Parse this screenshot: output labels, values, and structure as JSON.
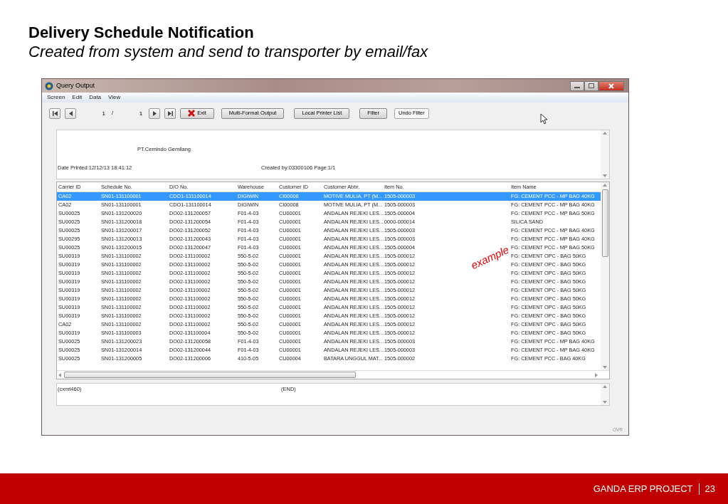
{
  "slide": {
    "title": "Delivery Schedule Notification",
    "subtitle": "Created from system and send to transporter by email/fax",
    "annotation": "example",
    "footer": {
      "project": "GANDA ERP PROJECT",
      "page": "23"
    }
  },
  "window": {
    "title": "Query Output",
    "menu": [
      "Screen",
      "Edit",
      "Data",
      "View"
    ],
    "toolbar": [
      {
        "kind": "first"
      },
      {
        "kind": "prev"
      },
      {
        "kind": "field",
        "value": "1"
      },
      {
        "kind": "text",
        "label": "/"
      },
      {
        "kind": "field",
        "value": "1"
      },
      {
        "kind": "next"
      },
      {
        "kind": "last"
      },
      {
        "kind": "exit",
        "label": "Exit"
      },
      {
        "kind": "button",
        "label": "Multi-Format Output"
      },
      {
        "kind": "button",
        "label": "Local Printer List"
      },
      {
        "kind": "button",
        "label": "Filter"
      },
      {
        "kind": "flat",
        "label": "Undo Filter"
      }
    ],
    "report_header": {
      "company": "PT.Cemindo Gemilang",
      "date_printed": "Date Printed:12/12/13 18:41:12",
      "created_by": "Created by:03300106  Page:1/1"
    },
    "table": {
      "columns": [
        "Carrier ID",
        "Schedule No.",
        "D/O No.",
        "Warehouse",
        "Customer ID",
        "Customer Abbr.",
        "Item No.",
        "Item Name"
      ],
      "rows": [
        {
          "selected": true,
          "cells": [
            "CA02",
            "SN01-131100001",
            "CDO1-131100014",
            "DIGIWIN",
            "CI00008",
            "MOTIVE MULIA, PT (M...",
            "1505-000003",
            "FG: CEMENT PCC - MP BAG 40KG"
          ]
        },
        {
          "selected": false,
          "cells": [
            "CA02",
            "SN01-131100001",
            "CDO1-131100014",
            "DIGIWIN",
            "CI00008",
            "MOTIVE MULIA, PT (M...",
            "1505-000003",
            "FG: CEMENT PCC - MP BAG 40KG"
          ]
        },
        {
          "selected": false,
          "cells": [
            "SU00025",
            "SN01-131200020",
            "DO02-131200057",
            "F01-4-03",
            "CU00001",
            "ANDALAN REJEKI LES...",
            "1505-000004",
            "FG: CEMENT PCC - MP BAG 50KG"
          ]
        },
        {
          "selected": false,
          "cells": [
            "SU00025",
            "SN01-131200018",
            "DO02-131200054",
            "F01-4-03",
            "CU00001",
            "ANDALAN REJEKI LES...",
            "0000-000014",
            "SILICA SAND"
          ]
        },
        {
          "selected": false,
          "cells": [
            "SU00025",
            "SN01-131200017",
            "DO02-131200052",
            "F01-4-03",
            "CU00001",
            "ANDALAN REJEKI LES...",
            "1505-000003",
            "FG: CEMENT PCC - MP BAG 40KG"
          ]
        },
        {
          "selected": false,
          "cells": [
            "SU00295",
            "SN01-131200013",
            "DO02-131200043",
            "F01-4-03",
            "CU00001",
            "ANDALAN REJEKI LES...",
            "1505-000003",
            "FG: CEMENT PCC - MP BAG 40KG"
          ]
        },
        {
          "selected": false,
          "cells": [
            "SU00025",
            "SN01-131200015",
            "DO02-131200047",
            "F01-4-03",
            "CU00001",
            "ANDALAN REJEKI LES...",
            "1505-000004",
            "FG: CEMENT PCC - MP BAG 50KG"
          ]
        },
        {
          "selected": false,
          "cells": [
            "SU00319",
            "SN01-131100002",
            "DO02-131100002",
            "550-5-02",
            "CU00001",
            "ANDALAN REJEKI LES...",
            "1505-000012",
            "FG: CEMENT OPC - BAG 50KG"
          ]
        },
        {
          "selected": false,
          "cells": [
            "SU00319",
            "SN01-131100002",
            "DO02-131100002",
            "550-5-02",
            "CU00001",
            "ANDALAN REJEKI LES...",
            "1505-000012",
            "FG: CEMENT OPC - BAG 50KG"
          ]
        },
        {
          "selected": false,
          "cells": [
            "SU00319",
            "SN01-131100002",
            "DO02-131100002",
            "550-5-02",
            "CU00001",
            "ANDALAN REJEKI LES...",
            "1505-000012",
            "FG: CEMENT OPC - BAG 50KG"
          ]
        },
        {
          "selected": false,
          "cells": [
            "SU00319",
            "SN01-131100002",
            "DO02-131100002",
            "550-5-02",
            "CU00001",
            "ANDALAN REJEKI LES...",
            "1505-000012",
            "FG: CEMENT OPC - BAG 50KG"
          ]
        },
        {
          "selected": false,
          "cells": [
            "SU00319",
            "SN01-131100002",
            "DO02-131100002",
            "550-5-02",
            "CU00001",
            "ANDALAN REJEKI LES...",
            "1505-000012",
            "FG: CEMENT OPC - BAG 50KG"
          ]
        },
        {
          "selected": false,
          "cells": [
            "SU00319",
            "SN01-131100002",
            "DO02-131100002",
            "550-5-02",
            "CU00001",
            "ANDALAN REJEKI LES...",
            "1505-000012",
            "FG: CEMENT OPC - BAG 50KG"
          ]
        },
        {
          "selected": false,
          "cells": [
            "SU00319",
            "SN01-131100002",
            "DO02-131100002",
            "550-5-02",
            "CU00001",
            "ANDALAN REJEKI LES...",
            "1505-000012",
            "FG: CEMENT OPC - BAG 50KG"
          ]
        },
        {
          "selected": false,
          "cells": [
            "SU00319",
            "SN01-131100002",
            "DO02-131100002",
            "550-5-02",
            "CU00001",
            "ANDALAN REJEKI LES...",
            "1505-000012",
            "FG: CEMENT OPC - BAG 50KG"
          ]
        },
        {
          "selected": false,
          "cells": [
            "CA02",
            "SN01-131100002",
            "DO02-131100002",
            "550-5-02",
            "CU00001",
            "ANDALAN REJEKI LES...",
            "1505-000012",
            "FG: CEMENT OPC - BAG 50KG"
          ]
        },
        {
          "selected": false,
          "cells": [
            "SU00319",
            "SN01-131100003",
            "DO02-131100004",
            "550-5-02",
            "CU00001",
            "ANDALAN REJEKI LES...",
            "1505-000012",
            "FG: CEMENT OPC - BAG 50KG"
          ]
        },
        {
          "selected": false,
          "cells": [
            "SU00025",
            "SN01-131200023",
            "DO02-131200058",
            "F01-4-03",
            "CU00001",
            "ANDALAN REJEKI LES...",
            "1505-000003",
            "FG: CEMENT PCC - MP BAG 40KG"
          ]
        },
        {
          "selected": false,
          "cells": [
            "SU00025",
            "SN01-131200014",
            "DO02-131200044",
            "F01-4-03",
            "CU00001",
            "ANDALAN REJEKI LES...",
            "1505-000003",
            "FG: CEMENT PCC - MP BAG 40KG"
          ]
        },
        {
          "selected": false,
          "cells": [
            "SU00025",
            "SN01-131200005",
            "DO02-131200006",
            "410-5-05",
            "CU00004",
            "BATARA UNGGUL MAT...",
            "1505-000002",
            "FG: CEMENT PCC - BAG 40KG"
          ]
        }
      ]
    },
    "report_footer": {
      "program": "(cxmt460)",
      "end": "(END)"
    },
    "status_bar": "OVR"
  }
}
